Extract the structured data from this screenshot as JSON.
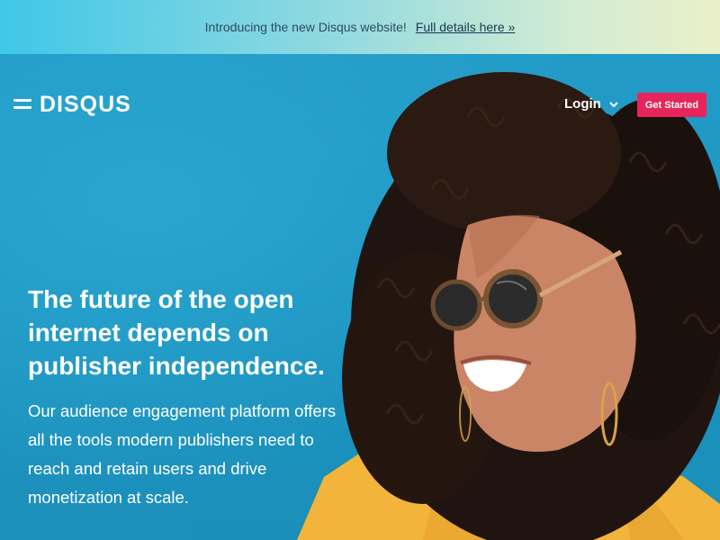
{
  "announcement": {
    "message": "Introducing the new Disqus website!",
    "link_label": "Full details here »"
  },
  "nav": {
    "menu_icon": "hamburger-menu-icon",
    "logo_text": "DISQUS",
    "login_label": "Login",
    "login_icon": "chevron-down-icon",
    "cta_label": "Get Started"
  },
  "hero": {
    "headline": "The future of the open internet depends on publisher independence.",
    "subcopy": "Our audience engagement platform offers all the tools modern publishers need to reach and retain users and drive monetization at scale.",
    "image": "woman-in-sunglasses-smiling-photo"
  },
  "colors": {
    "announcement_gradient_start": "#3ec7e8",
    "announcement_gradient_end": "#eaf0c8",
    "hero_background": "#229cc7",
    "cta_background": "#e8245c",
    "jacket_yellow": "#f2b43a"
  }
}
